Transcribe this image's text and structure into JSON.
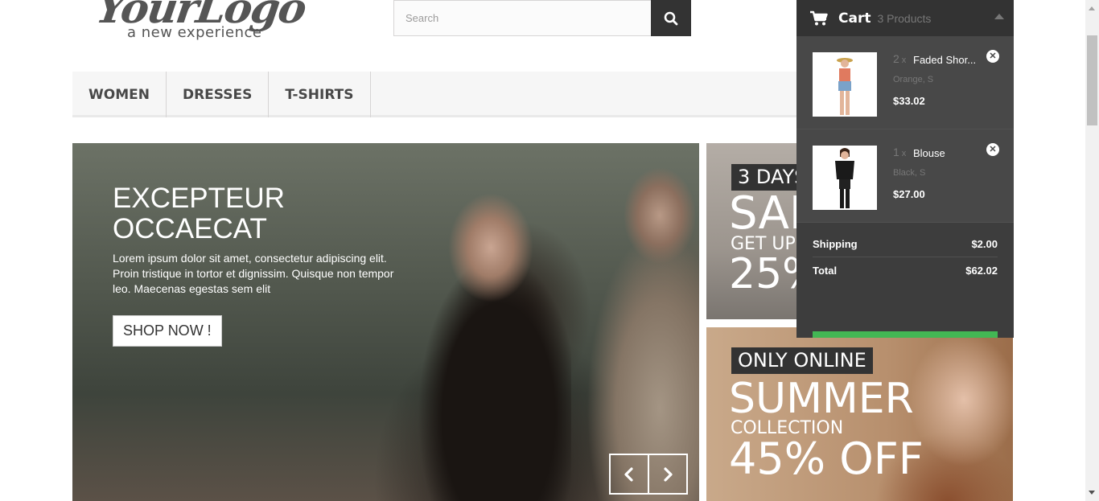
{
  "logo": {
    "script": "YourLogo",
    "tagline": "a new experience"
  },
  "search": {
    "placeholder": "Search",
    "button_icon": "search-icon"
  },
  "menu": {
    "items": [
      {
        "label": "WOMEN"
      },
      {
        "label": "DRESSES"
      },
      {
        "label": "T-SHIRTS"
      }
    ]
  },
  "hero": {
    "title_line1": "EXCEPTEUR",
    "title_line2": "OCCAECAT",
    "description": "Lorem ipsum dolor sit amet, consectetur adipiscing elit. Proin tristique in tortor et dignissim. Quisque non tempor leo. Maecenas egestas sem elit",
    "button": "SHOP NOW !",
    "prev_icon": "chevron-left-icon",
    "next_icon": "chevron-right-icon"
  },
  "banner1": {
    "tag": "3 DAYS",
    "big": "SAL",
    "sub": "GET UP",
    "percent": "25%"
  },
  "banner2": {
    "tag": "ONLY ONLINE",
    "big": "SUMMER",
    "sub": "COLLECTION",
    "percent": "45% OFF"
  },
  "cart": {
    "title": "Cart",
    "count": "3 Products",
    "products": [
      {
        "qty": "2",
        "x": "x",
        "name": "Faded Shor...",
        "attributes": "Orange, S",
        "price": "$33.02"
      },
      {
        "qty": "1",
        "x": "x",
        "name": "Blouse",
        "attributes": "Black, S",
        "price": "$27.00"
      }
    ],
    "shipping_label": "Shipping",
    "shipping_value": "$2.00",
    "total_label": "Total",
    "total_value": "$62.02"
  },
  "colors": {
    "dark": "#333333",
    "cart_bg": "#484848",
    "accent_green": "#43b754",
    "menu_bg": "#f6f6f6"
  }
}
